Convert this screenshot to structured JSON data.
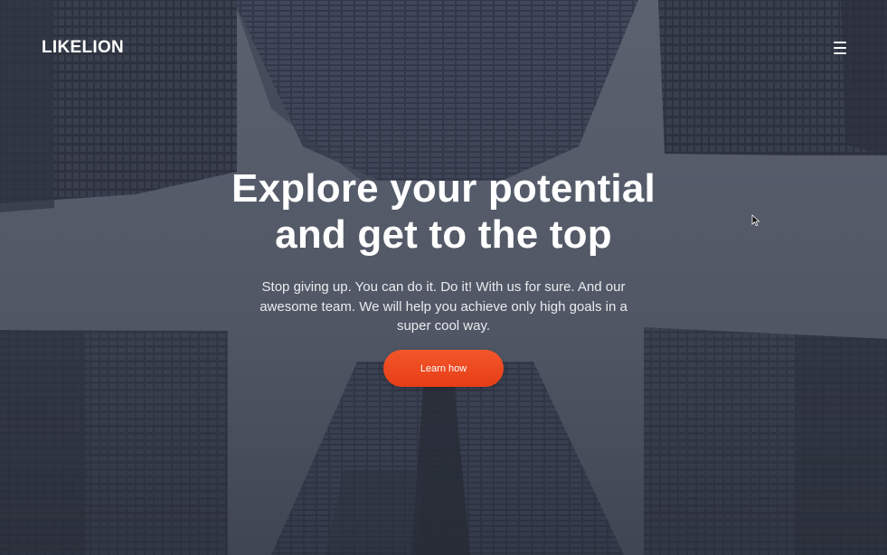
{
  "nav": {
    "logo": "LIKELION",
    "menu_icon": "hamburger-menu-icon"
  },
  "hero": {
    "headline_line1": "Explore your potential",
    "headline_line2": "and get to the top",
    "subtext_line1": "Stop giving up. You can do it. Do it! With us for sure. And our",
    "subtext_line2": "awesome team. We will help you achieve only high goals in a",
    "subtext_line3": "super cool way.",
    "cta_label": "Learn how"
  },
  "colors": {
    "accent": "#ef4a22",
    "overlay": "#4a505e",
    "text": "#ffffff"
  },
  "background_image": "skyscrapers-looking-up-photo",
  "cursor_icon": "mouse-pointer-icon"
}
